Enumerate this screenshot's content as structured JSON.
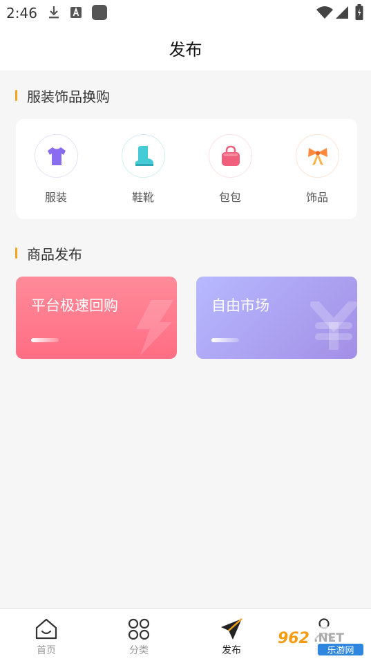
{
  "status_bar": {
    "time": "2:46",
    "icons": [
      "download-icon",
      "accessibility-a-icon",
      "app-square-icon",
      "wifi-icon",
      "cell-signal-icon",
      "battery-icon"
    ]
  },
  "header": {
    "title": "发布"
  },
  "categories_section": {
    "title": "服装饰品换购",
    "items": [
      {
        "label": "服装",
        "icon": "tshirt-icon",
        "color": "#8a6cf0"
      },
      {
        "label": "鞋靴",
        "icon": "boot-icon",
        "color": "#43cbd6"
      },
      {
        "label": "包包",
        "icon": "handbag-icon",
        "color": "#f0607d"
      },
      {
        "label": "饰品",
        "icon": "bow-icon",
        "color": "#ff8a3d"
      }
    ]
  },
  "publish_section": {
    "title": "商品发布",
    "cards": [
      {
        "title": "平台极速回购",
        "icon": "lightning-icon"
      },
      {
        "title": "自由市场",
        "icon": "yen-icon"
      }
    ]
  },
  "tabbar": {
    "tabs": [
      {
        "label": "首页",
        "icon": "home-icon",
        "active": false
      },
      {
        "label": "分类",
        "icon": "category-grid-icon",
        "active": false
      },
      {
        "label": "发布",
        "icon": "paper-plane-icon",
        "active": true
      },
      {
        "label": "我的",
        "icon": "person-icon",
        "active": false
      }
    ]
  },
  "watermark": {
    "text_top": "962.NET",
    "text_bottom": "乐游网"
  },
  "colors": {
    "accent": "#f3a41e",
    "platform_card": "#ff7a8c",
    "market_card": "#ad9ff0",
    "active_tab": "#222222"
  }
}
